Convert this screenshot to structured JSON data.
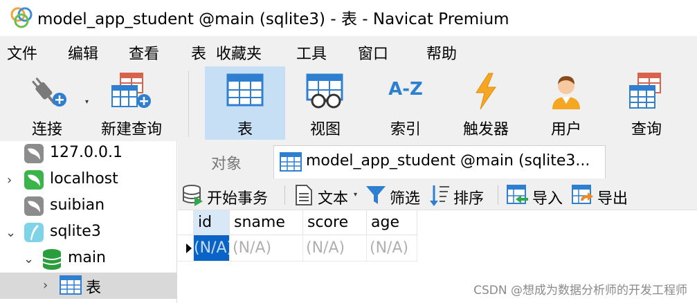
{
  "window": {
    "title": "model_app_student @main (sqlite3) - 表 - Navicat Premium"
  },
  "menu": {
    "items": [
      "文件",
      "编辑",
      "查看",
      "表",
      "收藏夹",
      "工具",
      "窗口",
      "帮助"
    ]
  },
  "toolbar": {
    "connect_label": "连接",
    "new_query_label": "新建查询",
    "table_label": "表",
    "view_label": "视图",
    "index_label": "索引",
    "index_icon_text": "A-Z",
    "trigger_label": "触发器",
    "user_label": "用户",
    "query_label": "查询",
    "active_tool": "table"
  },
  "tree": {
    "items": [
      {
        "label": "127.0.0.1",
        "icon": "mysql-connection-icon"
      },
      {
        "label": "localhost",
        "icon": "mysql-connection-icon"
      },
      {
        "label": "suibian",
        "icon": "mysql-connection-icon"
      },
      {
        "label": "sqlite3",
        "icon": "sqlite-connection-icon"
      },
      {
        "label": "main",
        "icon": "database-icon"
      },
      {
        "label": "表",
        "icon": "table-icon"
      }
    ]
  },
  "tabs": {
    "objects_label": "对象",
    "table_tab_label": "model_app_student @main (sqlite3..."
  },
  "subtoolbar": {
    "begin_transaction": "开始事务",
    "text": "文本",
    "filter": "筛选",
    "sort": "排序",
    "import": "导入",
    "export": "导出"
  },
  "grid": {
    "columns": [
      "id",
      "sname",
      "score",
      "age"
    ],
    "rows": [
      [
        "(N/A)",
        "(N/A)",
        "(N/A)",
        "(N/A)"
      ]
    ]
  },
  "watermark": "CSDN @想成为数据分析师的开发工程师",
  "colors": {
    "accent": "#0a64c8",
    "active_tool_bg": "#c7dff5",
    "selected_tree_bg": "#d9d9d9"
  }
}
